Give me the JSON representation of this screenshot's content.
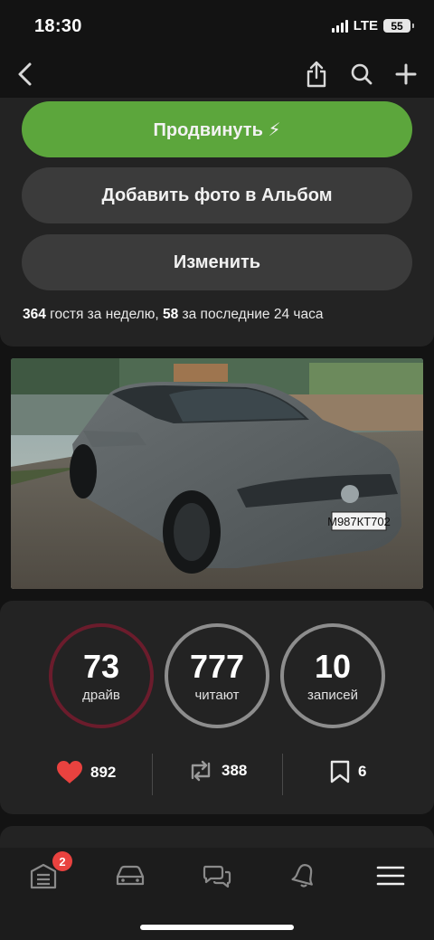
{
  "status_bar": {
    "time": "18:30",
    "network": "LTE",
    "battery": "55"
  },
  "nav": {
    "back_icon": "chevron-left-icon",
    "share_icon": "share-icon",
    "search_icon": "search-icon",
    "add_icon": "plus-icon"
  },
  "actions": {
    "promote_label": "Продвинуть ⚡",
    "add_photo_label": "Добавить фото в Альбом",
    "edit_label": "Изменить"
  },
  "guests": {
    "week_count": "364",
    "week_text": " гостя за неделю, ",
    "day_count": "58",
    "day_text": " за последние 24 часа"
  },
  "car_photo": {
    "plate": "М987КТ702"
  },
  "stats": [
    {
      "value": "73",
      "label": "драйв"
    },
    {
      "value": "777",
      "label": "читают"
    },
    {
      "value": "10",
      "label": "записей"
    }
  ],
  "counters": {
    "likes": "892",
    "reposts": "388",
    "bookmarks": "6"
  },
  "tabbar": {
    "garage_badge": "2"
  },
  "colors": {
    "accent_green": "#5ca63c",
    "like_red": "#e9423f",
    "card_bg": "#232323",
    "drive_ring": "#6b1c2c"
  }
}
